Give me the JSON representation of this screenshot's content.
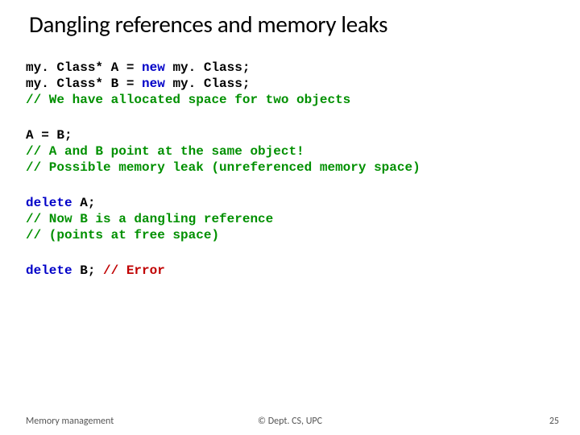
{
  "title": "Dangling references and memory leaks",
  "code": {
    "b1": {
      "l1a": "my. Class* A = ",
      "l1kw": "new",
      "l1b": " my. Class;",
      "l2a": "my. Class* B = ",
      "l2kw": "new",
      "l2b": " my. Class;",
      "c1": "// We have allocated space for two objects"
    },
    "b2": {
      "l1": "A = B;",
      "c1": "// A and B point at the same object!",
      "c2": "// Possible memory leak (unreferenced memory space)"
    },
    "b3": {
      "kw1": "delete",
      "l1": " A;",
      "c1": "// Now B is a dangling reference",
      "c2": "// (points at free space)"
    },
    "b4": {
      "kw1": "delete",
      "l1": " B; ",
      "err": "// Error"
    }
  },
  "footer": {
    "left": "Memory management",
    "center": "© Dept. CS, UPC",
    "right": "25"
  }
}
